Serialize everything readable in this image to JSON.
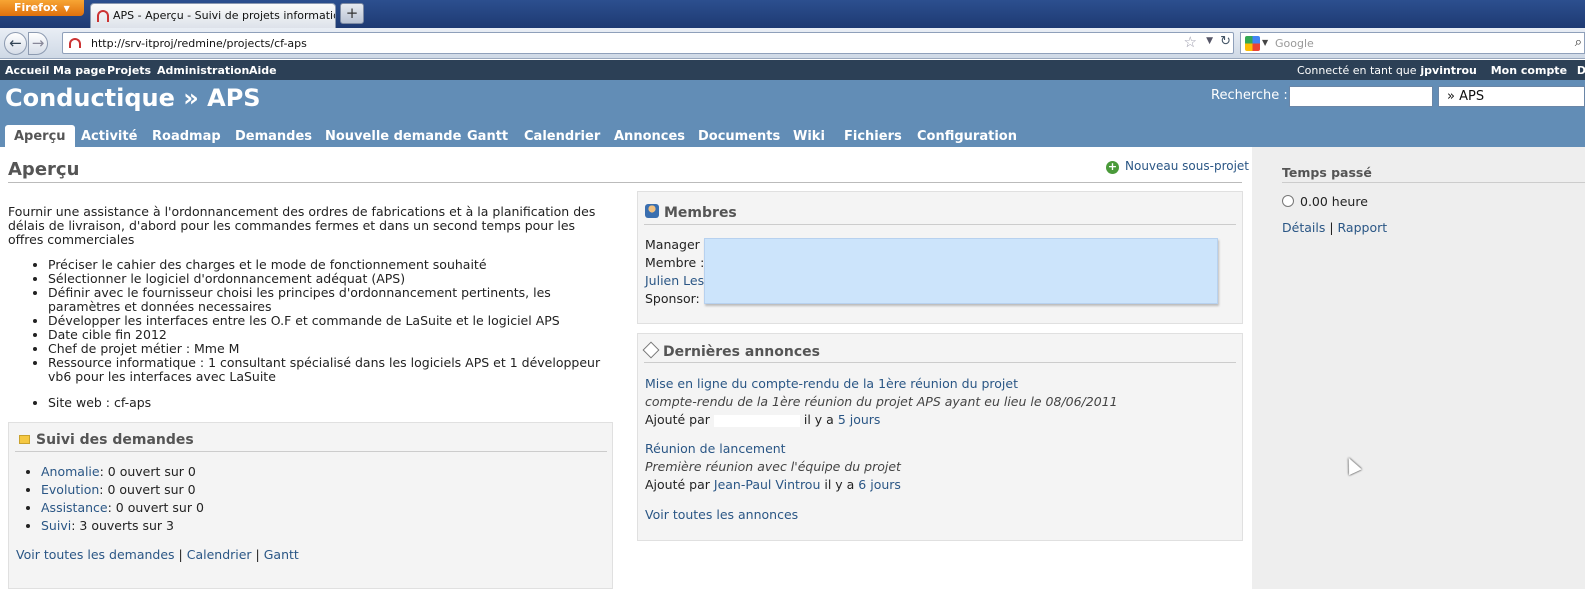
{
  "browser": {
    "menu_button": "Firefox",
    "tab_title": "APS - Aperçu - Suivi de projets informatique...",
    "url": "http://srv-itproj/redmine/projects/cf-aps",
    "search_placeholder": "Google"
  },
  "topmenu": {
    "items": [
      "Accueil",
      "Ma page",
      "Projets",
      "Administration",
      "Aide"
    ],
    "logged_prefix": "Connecté en tant que",
    "user": "jpvintrou",
    "account": "Mon compte",
    "extra": "D"
  },
  "header": {
    "title": "Conductique » APS",
    "search_label": "Recherche :",
    "jump_value": "» APS"
  },
  "mainmenu": [
    "Aperçu",
    "Activité",
    "Roadmap",
    "Demandes",
    "Nouvelle demande",
    "Gantt",
    "Calendrier",
    "Annonces",
    "Documents",
    "Wiki",
    "Fichiers",
    "Configuration"
  ],
  "content": {
    "title": "Aperçu",
    "new_subproject": "Nouveau sous-projet",
    "description": "Fournir une assistance à l'ordonnancement des ordres de fabrications et à la planification des délais de livraison, d'abord pour les commandes fermes et dans un second temps pour les offres commerciales",
    "bullets": [
      "Préciser le cahier des charges et le mode de fonctionnement souhaité",
      "Sélectionner le logiciel d'ordonnancement adéquat (APS)",
      "Définir avec le fournisseur choisi les principes d'ordonnancement pertinents, les paramètres et données necessaires",
      "Développer les interfaces entre les O.F et commande de LaSuite et le logiciel APS",
      "Date cible fin 2012",
      "Chef de projet métier : Mme M",
      "Ressource informatique : 1 consultant spécialisé dans les logiciels APS et 1 développeur vb6 pour les interfaces avec LaSuite"
    ],
    "site_web": "Site web : cf-aps"
  },
  "suivi": {
    "title": "Suivi des demandes",
    "items": [
      {
        "tracker": "Anomalie",
        "count": ": 0 ouvert sur 0"
      },
      {
        "tracker": "Evolution",
        "count": ": 0 ouvert sur 0"
      },
      {
        "tracker": "Assistance",
        "count": ": 0 ouvert sur 0"
      },
      {
        "tracker": "Suivi",
        "count": ": 3 ouverts sur 3"
      }
    ],
    "link_all": "Voir toutes les demandes",
    "link_cal": "Calendrier",
    "link_gantt": "Gantt"
  },
  "membres": {
    "title": "Membres",
    "rows": [
      "Manager",
      "Membre :",
      "Julien Les",
      "Sponsor:"
    ]
  },
  "annonces": {
    "title": "Dernières annonces",
    "items": [
      {
        "title": "Mise en ligne du compte-rendu de la 1ère réunion du projet",
        "summary": "compte-rendu de la 1ère réunion du projet APS ayant eu lieu le 08/06/2011",
        "added_by": "Ajouté par",
        "author": "",
        "ago": "il y a",
        "when": "5 jours"
      },
      {
        "title": "Réunion de lancement",
        "summary": "Première réunion avec l'équipe du projet",
        "added_by": "Ajouté par",
        "author": "Jean-Paul Vintrou",
        "ago": "il y a",
        "when": "6 jours"
      }
    ],
    "link_all": "Voir toutes les annonces"
  },
  "sidebar": {
    "title": "Temps passé",
    "hours": "0.00 heure",
    "link_details": "Détails",
    "link_report": "Rapport"
  }
}
